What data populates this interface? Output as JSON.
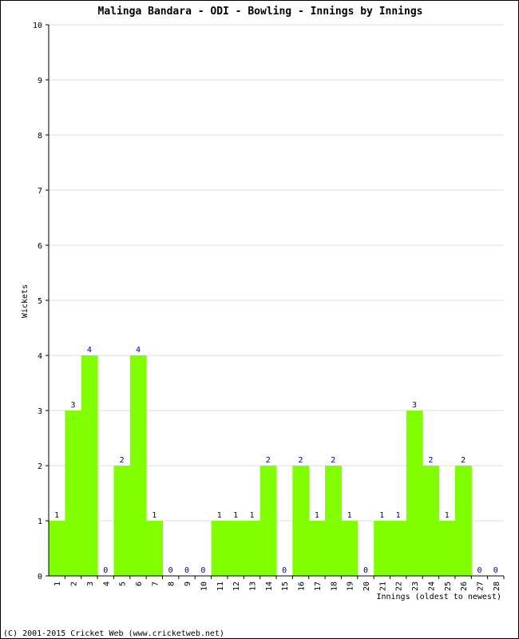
{
  "chart_data": {
    "type": "bar",
    "title": "Malinga Bandara - ODI - Bowling - Innings by Innings",
    "xlabel": "Innings (oldest to newest)",
    "ylabel": "Wickets",
    "ylim": [
      0,
      10
    ],
    "yticks": [
      0,
      1,
      2,
      3,
      4,
      5,
      6,
      7,
      8,
      9,
      10
    ],
    "grid": true,
    "bar_color": "#7fff00",
    "label_color": "#000080",
    "categories": [
      "1",
      "2",
      "3",
      "4",
      "5",
      "6",
      "7",
      "8",
      "9",
      "10",
      "11",
      "12",
      "13",
      "14",
      "15",
      "16",
      "17",
      "18",
      "19",
      "20",
      "21",
      "22",
      "23",
      "24",
      "25",
      "26",
      "27",
      "28"
    ],
    "values": [
      1,
      3,
      4,
      0,
      2,
      4,
      1,
      0,
      0,
      0,
      1,
      1,
      1,
      2,
      0,
      2,
      1,
      2,
      1,
      0,
      1,
      1,
      3,
      2,
      1,
      2,
      0,
      0
    ]
  },
  "footer": "(C) 2001-2015 Cricket Web (www.cricketweb.net)"
}
